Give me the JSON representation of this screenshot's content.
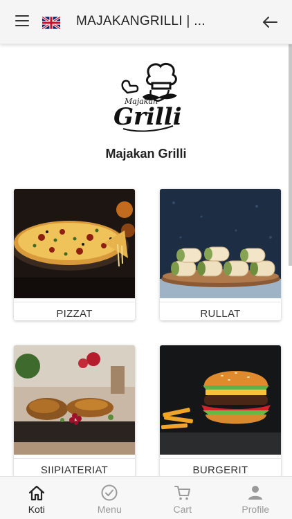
{
  "header": {
    "title": "MAJAKANGRILLI | ...",
    "menu_icon": "hamburger-menu-icon",
    "language_icon": "uk-flag-icon",
    "back_icon": "arrow-left-icon"
  },
  "shop": {
    "name": "Majakan Grilli",
    "logo_text_top": "Majakan",
    "logo_text_main": "Grilli"
  },
  "categories": [
    {
      "label": "PIZZAT"
    },
    {
      "label": "RULLAT"
    },
    {
      "label": "SIIPIATERIAT"
    },
    {
      "label": "BURGERIT"
    }
  ],
  "bottom_nav": [
    {
      "label": "Koti",
      "icon": "home-icon",
      "active": true
    },
    {
      "label": "Menu",
      "icon": "check-circle-icon",
      "active": false
    },
    {
      "label": "Cart",
      "icon": "cart-icon",
      "active": false
    },
    {
      "label": "Profile",
      "icon": "person-icon",
      "active": false
    }
  ],
  "colors": {
    "active": "#222222",
    "inactive": "#9a9a9a",
    "appbar": "#f5f5f6"
  }
}
